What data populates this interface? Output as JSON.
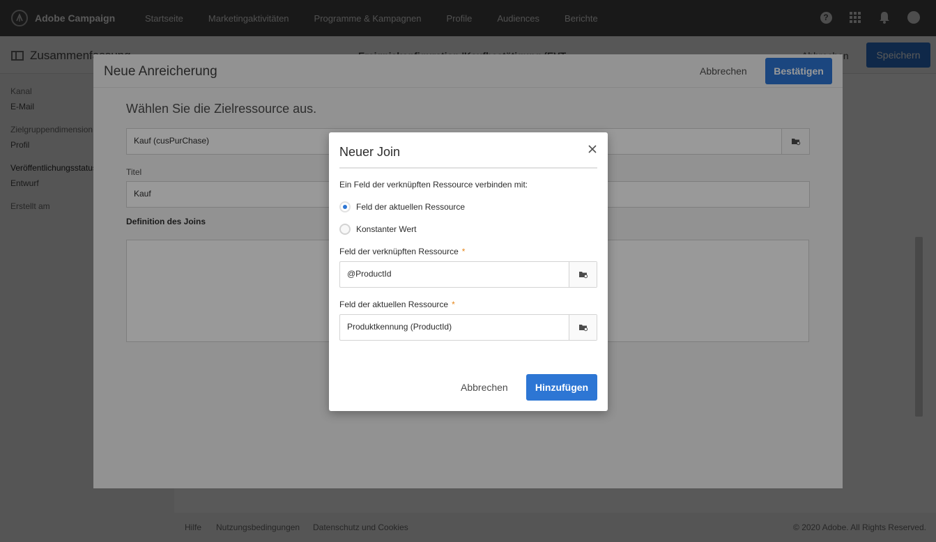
{
  "topbar": {
    "app_name": "Adobe Campaign",
    "nav": [
      "Startseite",
      "Marketingaktivitäten",
      "Programme & Kampagnen",
      "Profile",
      "Audiences",
      "Berichte"
    ],
    "icons": [
      "help-icon",
      "apps-grid-icon",
      "bell-icon",
      "user-avatar"
    ]
  },
  "subheader": {
    "summary_title": "Zusammenfassung",
    "page_heading": "Ereigniskonfiguration 'Kaufbestätigung (EVT...",
    "cancel_label": "Abbrechen",
    "save_label": "Speichern"
  },
  "sidebar": {
    "channel_label": "Kanal",
    "channel_value": "E-Mail",
    "target_label": "Zielgruppendimension",
    "target_value": "Profil",
    "status_label": "Veröffentlichungsstatus",
    "status_value": "Entwurf",
    "created_label": "Erstellt am"
  },
  "footer": {
    "links": [
      "Hilfe",
      "Nutzungsbedingungen",
      "Datenschutz und Cookies"
    ],
    "copyright": "© 2020 Adobe. All Rights Reserved."
  },
  "enrichment": {
    "title": "Neue Anreicherung",
    "cancel_label": "Abbrechen",
    "confirm_label": "Bestätigen",
    "subtitle": "Wählen Sie die Zielressource aus.",
    "target_resource_value": "Kauf (cusPurChase)",
    "title_label": "Titel",
    "title_value": "Kauf",
    "join_definition_label": "Definition des Joins"
  },
  "join_modal": {
    "title": "Neuer Join",
    "intro": "Ein Feld der verknüpften Ressource verbinden mit:",
    "radio_options": [
      {
        "label": "Feld der aktuellen Ressource",
        "checked": true
      },
      {
        "label": "Konstanter Wert",
        "checked": false
      }
    ],
    "linked_field_label": "Feld der verknüpften Ressource",
    "linked_field_value": "@ProductId",
    "current_field_label": "Feld der aktuellen Ressource",
    "current_field_value": "Produktkennung (ProductId)",
    "required_marker": "*",
    "cancel_label": "Abbrechen",
    "add_label": "Hinzufügen"
  },
  "colors": {
    "primary": "#2d76d4",
    "topbar": "#4b4b4b",
    "required": "#e68619"
  }
}
